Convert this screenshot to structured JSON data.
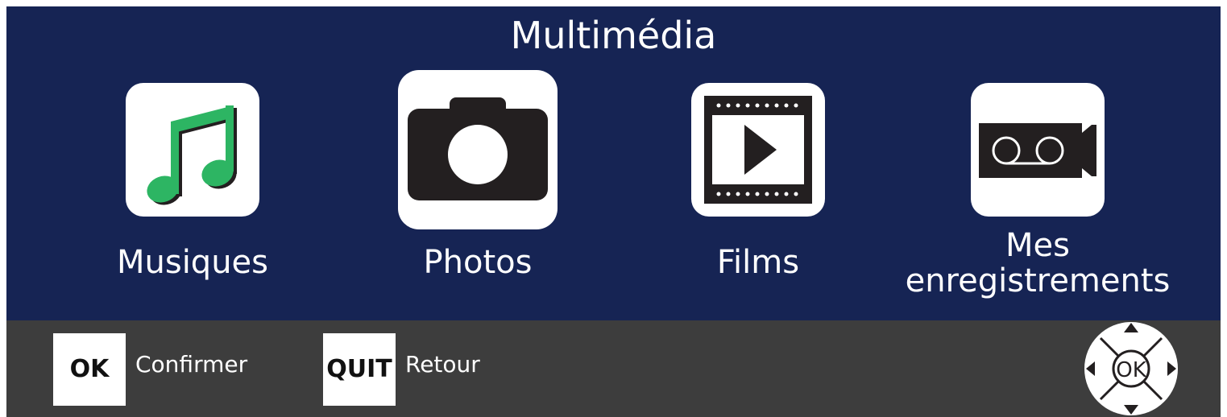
{
  "header": {
    "title": "Multimédia"
  },
  "menu": {
    "items": [
      {
        "label": "Musiques",
        "icon": "music-note-icon",
        "selected": false
      },
      {
        "label": "Photos",
        "icon": "camera-icon",
        "selected": true
      },
      {
        "label": "Films",
        "icon": "film-play-icon",
        "selected": false
      },
      {
        "label_line1": "Mes",
        "label_line2": "enregistrements",
        "icon": "video-recording-icon",
        "selected": false
      }
    ]
  },
  "footer": {
    "ok_key": "OK",
    "ok_hint": "Confirmer",
    "quit_key": "QUIT",
    "quit_hint": "Retour",
    "dpad_center": "OK"
  },
  "colors": {
    "background": "#162454",
    "footer": "#3d3d3d",
    "music_green": "#2db563",
    "icon_dark": "#231f20"
  }
}
